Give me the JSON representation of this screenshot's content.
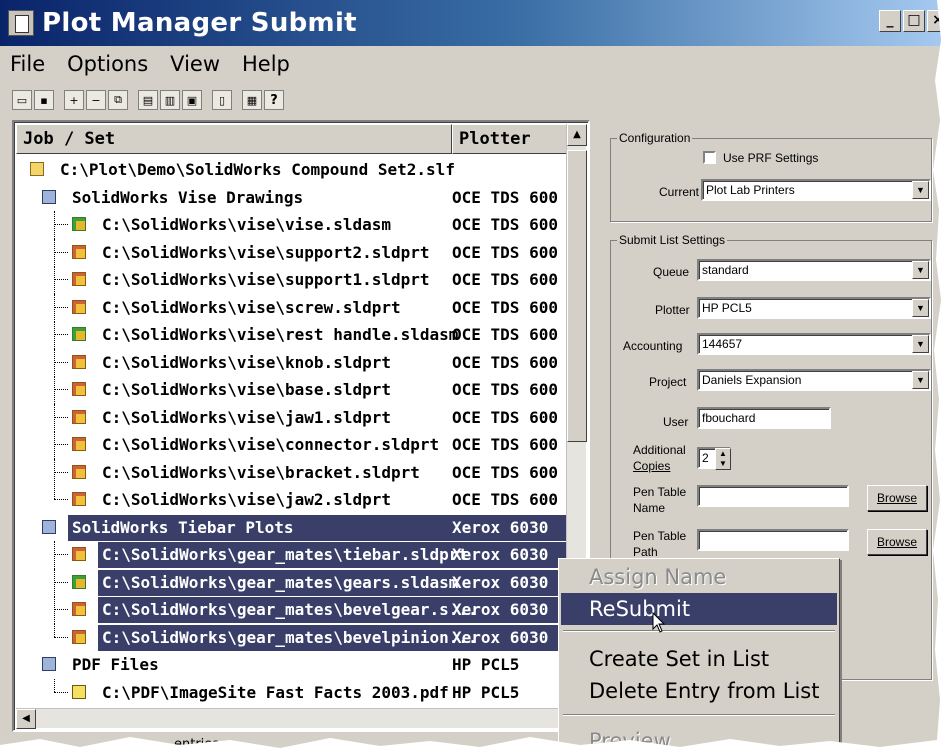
{
  "window": {
    "title": "Plot Manager Submit",
    "controls": [
      "_",
      "□",
      "×"
    ]
  },
  "menu": [
    "File",
    "Options",
    "View",
    "Help"
  ],
  "toolbar": {
    "icons": [
      "open-icon",
      "save-icon",
      "add-file-icon",
      "remove-file-icon",
      "copy-icon",
      "submit-icon",
      "submit-all-icon",
      "properties-icon",
      "preview-icon",
      "plot-icon",
      "help-icon"
    ]
  },
  "list": {
    "header_job": "Job / Set",
    "header_plotter": "Plotter",
    "rows": [
      {
        "job": "C:\\Plot\\Demo\\SolidWorks Compound Set2.slf",
        "plotter": "",
        "icon": "folder",
        "level": 0,
        "selected": false
      },
      {
        "job": "SolidWorks Vise Drawings",
        "plotter": "OCE TDS 600",
        "icon": "set",
        "level": 1,
        "selected": false
      },
      {
        "job": "C:\\SolidWorks\\vise\\vise.sldasm",
        "plotter": "OCE TDS 600",
        "icon": "asm",
        "level": 2,
        "selected": false
      },
      {
        "job": "C:\\SolidWorks\\vise\\support2.sldprt",
        "plotter": "OCE TDS 600",
        "icon": "part",
        "level": 2,
        "selected": false
      },
      {
        "job": "C:\\SolidWorks\\vise\\support1.sldprt",
        "plotter": "OCE TDS 600",
        "icon": "part",
        "level": 2,
        "selected": false
      },
      {
        "job": "C:\\SolidWorks\\vise\\screw.sldprt",
        "plotter": "OCE TDS 600",
        "icon": "part",
        "level": 2,
        "selected": false
      },
      {
        "job": "C:\\SolidWorks\\vise\\rest handle.sldasm",
        "plotter": "OCE TDS 600",
        "icon": "asm",
        "level": 2,
        "selected": false
      },
      {
        "job": "C:\\SolidWorks\\vise\\knob.sldprt",
        "plotter": "OCE TDS 600",
        "icon": "part",
        "level": 2,
        "selected": false
      },
      {
        "job": "C:\\SolidWorks\\vise\\base.sldprt",
        "plotter": "OCE TDS 600",
        "icon": "part",
        "level": 2,
        "selected": false
      },
      {
        "job": "C:\\SolidWorks\\vise\\jaw1.sldprt",
        "plotter": "OCE TDS 600",
        "icon": "part",
        "level": 2,
        "selected": false
      },
      {
        "job": "C:\\SolidWorks\\vise\\connector.sldprt",
        "plotter": "OCE TDS 600",
        "icon": "part",
        "level": 2,
        "selected": false
      },
      {
        "job": "C:\\SolidWorks\\vise\\bracket.sldprt",
        "plotter": "OCE TDS 600",
        "icon": "part",
        "level": 2,
        "selected": false
      },
      {
        "job": "C:\\SolidWorks\\vise\\jaw2.sldprt",
        "plotter": "OCE TDS 600",
        "icon": "part",
        "level": 2,
        "selected": false
      },
      {
        "job": "SolidWorks Tiebar Plots",
        "plotter": "Xerox 6030",
        "icon": "set",
        "level": 1,
        "selected": true
      },
      {
        "job": "C:\\SolidWorks\\gear_mates\\tiebar.sldprt",
        "plotter": "Xerox 6030",
        "icon": "part",
        "level": 2,
        "selected": true
      },
      {
        "job": "C:\\SolidWorks\\gear_mates\\gears.sldasm",
        "plotter": "Xerox 6030",
        "icon": "asm",
        "level": 2,
        "selected": true
      },
      {
        "job": "C:\\SolidWorks\\gear_mates\\bevelgear.s...",
        "plotter": "Xerox 6030",
        "icon": "part",
        "level": 2,
        "selected": true
      },
      {
        "job": "C:\\SolidWorks\\gear_mates\\bevelpinion...",
        "plotter": "Xerox 6030",
        "icon": "part",
        "level": 2,
        "selected": true
      },
      {
        "job": "PDF Files",
        "plotter": "HP PCL5",
        "icon": "set",
        "level": 1,
        "selected": false
      },
      {
        "job": "C:\\PDF\\ImageSite Fast Facts 2003.pdf",
        "plotter": "HP PCL5",
        "icon": "pdf",
        "level": 2,
        "selected": false
      }
    ]
  },
  "configuration": {
    "group_title": "Configuration",
    "use_prf_label": "Use PRF Settings",
    "use_prf_checked": false,
    "current_label": "Current",
    "current_value": "Plot Lab Printers"
  },
  "submit_settings": {
    "group_title": "Submit List Settings",
    "queue_label": "Queue",
    "queue_value": "standard",
    "plotter_label": "Plotter",
    "plotter_value": "HP PCL5",
    "accounting_label": "Accounting",
    "accounting_value": "144657",
    "project_label": "Project",
    "project_value": "Daniels Expansion",
    "user_label": "User",
    "user_value": "fbouchard",
    "copies_label_1": "Additional",
    "copies_label_2": "Copies",
    "copies_value": "2",
    "pen_name_label_1": "Pen Table",
    "pen_name_label_2": "Name",
    "pen_name_value": "",
    "pen_path_label_1": "Pen Table",
    "pen_path_label_2": "Path",
    "pen_path_value": "",
    "browse_label": "Browse"
  },
  "context_menu": {
    "items": [
      {
        "label": "Assign Name",
        "state": "disabled"
      },
      {
        "label": "ReSubmit",
        "state": "highlighted"
      },
      {
        "label": "Create Set in List",
        "state": "normal"
      },
      {
        "label": "Delete Entry from List",
        "state": "normal"
      },
      {
        "label": "Preview",
        "state": "disabled"
      }
    ]
  },
  "status": {
    "text": "entries"
  },
  "colors": {
    "selection": "#3a3f6a",
    "titlebar_start": "#0a246a",
    "titlebar_end": "#a6caf0",
    "face": "#d4d0c8"
  }
}
